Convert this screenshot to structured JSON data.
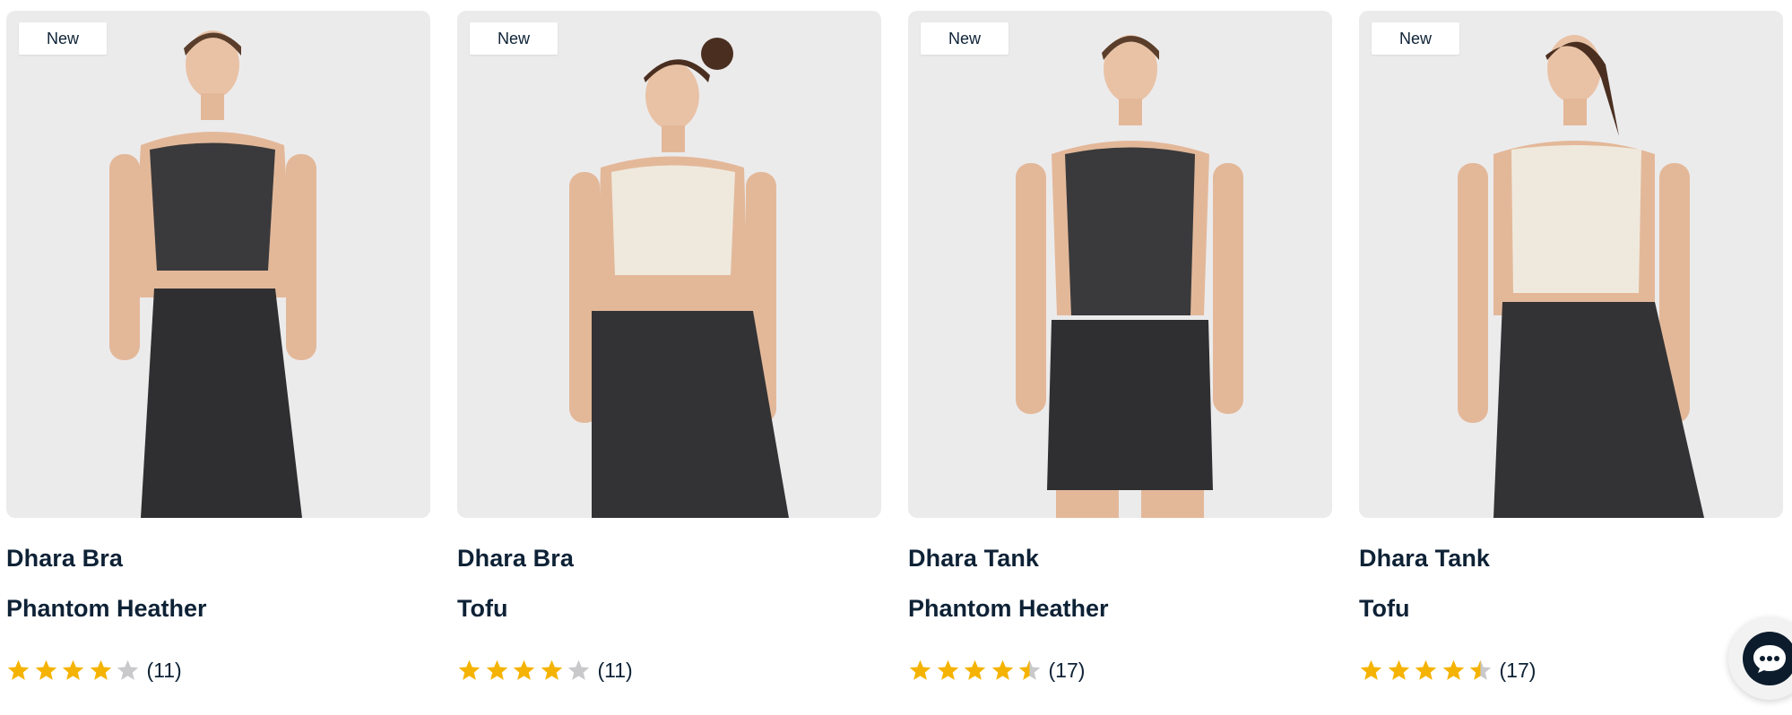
{
  "colors": {
    "accent_star": "#f5b301",
    "empty_star": "#c9c9cc",
    "text": "#0e2236",
    "image_bg": "#ecebec"
  },
  "products": [
    {
      "badge": "New",
      "name": "Dhara Bra",
      "color": "Phantom Heather",
      "rating": 4,
      "count": "(11)",
      "top_color": "#3a3a3c",
      "bottom_color": "#2f2f31",
      "bottom": "leggings"
    },
    {
      "badge": "New",
      "name": "Dhara Bra",
      "color": "Tofu",
      "rating": 4,
      "count": "(11)",
      "top_color": "#efe9dd",
      "bottom_color": "#333335",
      "bottom": "joggers"
    },
    {
      "badge": "New",
      "name": "Dhara Tank",
      "color": "Phantom Heather",
      "rating": 4.5,
      "count": "(17)",
      "top_color": "#3a3a3c",
      "bottom_color": "#2f2f31",
      "bottom": "shorts"
    },
    {
      "badge": "New",
      "name": "Dhara Tank",
      "color": "Tofu",
      "rating": 4.5,
      "count": "(17)",
      "top_color": "#efe9dd",
      "bottom_color": "#333335",
      "bottom": "leggings"
    }
  ],
  "chat": {
    "icon": "chat-bubble-icon"
  }
}
